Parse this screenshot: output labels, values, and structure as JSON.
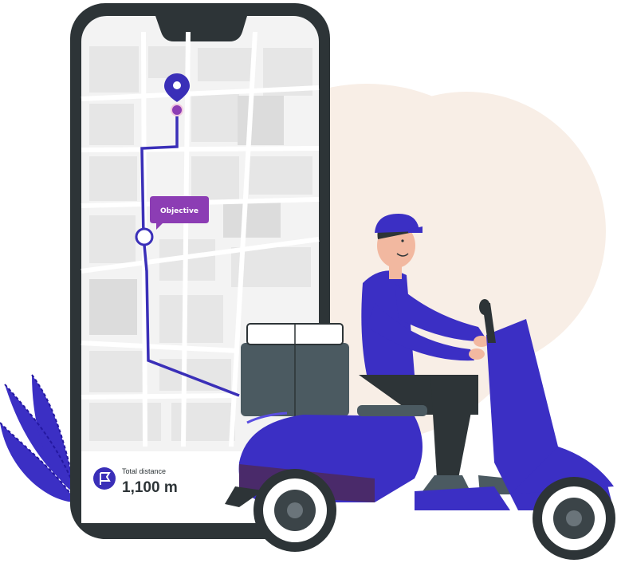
{
  "map": {
    "objective_label": "Objective"
  },
  "distance_card": {
    "label": "Total distance",
    "value": "1,100 m",
    "icon": "flag-icon"
  },
  "colors": {
    "accent_purple": "#8c3db4",
    "route_blue": "#3a2fb8",
    "scooter_blue": "#3b2fc4",
    "phone_frame": "#2d3437",
    "backdrop_peach": "#f7ece3"
  }
}
